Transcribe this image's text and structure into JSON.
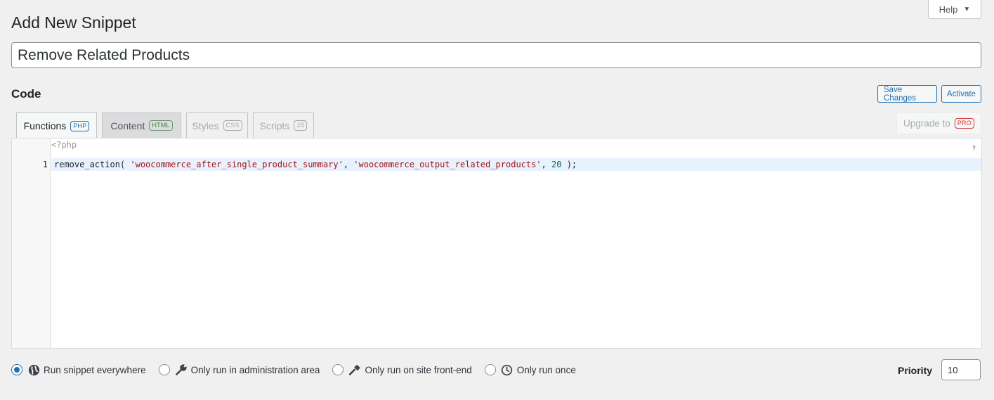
{
  "header": {
    "page_title": "Add New Snippet",
    "help_label": "Help"
  },
  "snippet": {
    "title_value": "Remove Related Products"
  },
  "code_section": {
    "heading": "Code",
    "save_label": "Save Changes",
    "activate_label": "Activate"
  },
  "tabs": [
    {
      "label": "Functions",
      "badge": "PHP"
    },
    {
      "label": "Content",
      "badge": "HTML"
    },
    {
      "label": "Styles",
      "badge": "CSS"
    },
    {
      "label": "Scripts",
      "badge": "JS"
    }
  ],
  "upgrade": {
    "label": "Upgrade to",
    "badge": "PRO"
  },
  "editor": {
    "php_open_tag": "<?php",
    "help_marker": "?",
    "line_number": "1",
    "code": {
      "func": "remove_action( ",
      "arg1": "'woocommerce_after_single_product_summary'",
      "sep1": ", ",
      "arg2": "'woocommerce_output_related_products'",
      "sep2": ", ",
      "arg3": "20",
      "end": " );"
    }
  },
  "scope": {
    "options": [
      {
        "label": "Run snippet everywhere",
        "icon": "globe-icon",
        "checked": true
      },
      {
        "label": "Only run in administration area",
        "icon": "wrench-icon",
        "checked": false
      },
      {
        "label": "Only run on site front-end",
        "icon": "hammer-icon",
        "checked": false
      },
      {
        "label": "Only run once",
        "icon": "clock-icon",
        "checked": false
      }
    ]
  },
  "priority": {
    "label": "Priority",
    "value": "10"
  },
  "colors": {
    "accent": "#2271b1",
    "background": "#f0f0f1",
    "string": "#aa1111",
    "number": "#116644",
    "pro": "#d63638"
  }
}
